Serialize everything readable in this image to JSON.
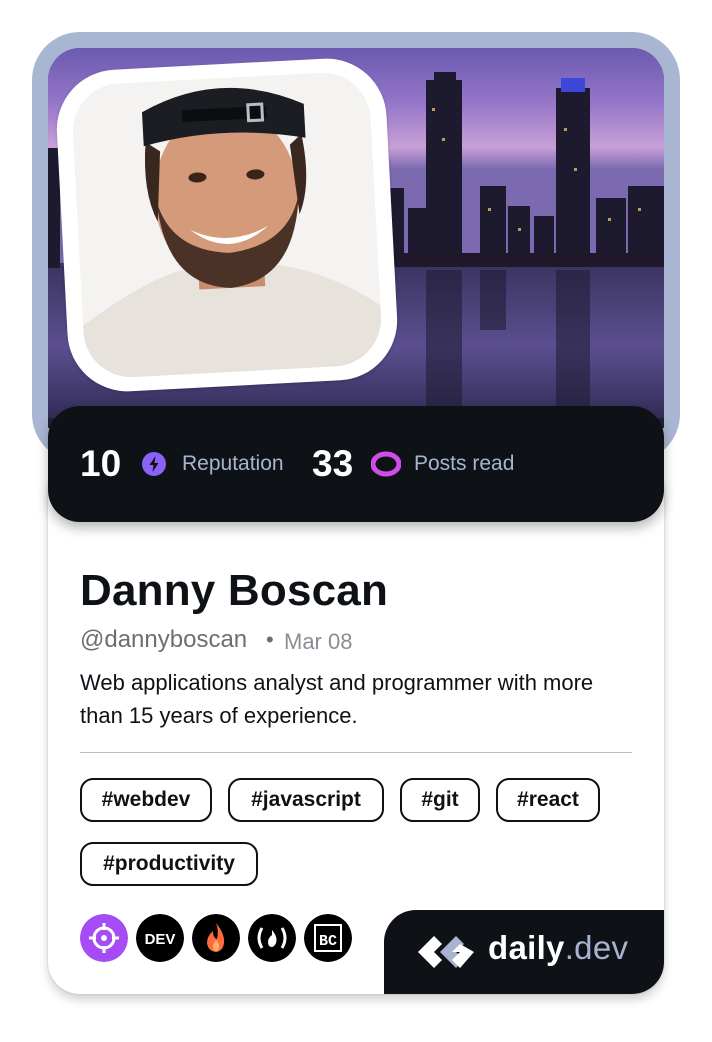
{
  "stats": {
    "reputation_value": "10",
    "reputation_label": "Reputation",
    "posts_value": "33",
    "posts_label": "Posts read"
  },
  "profile": {
    "name": "Danny Boscan",
    "handle": "@dannyboscan",
    "separator": "•",
    "date": "Mar 08",
    "bio": "Web applications analyst and programmer with more than 15 years of experience."
  },
  "tags": [
    "#webdev",
    "#javascript",
    "#git",
    "#react",
    "#productivity"
  ],
  "sources": [
    {
      "icon": "crosshair-icon",
      "color": "#a54cf5"
    },
    {
      "icon": "dev-icon",
      "color": "#000000"
    },
    {
      "icon": "flame-icon",
      "color": "#000000"
    },
    {
      "icon": "freecodecamp-icon",
      "color": "#000000"
    },
    {
      "icon": "bc-icon",
      "color": "#000000"
    }
  ],
  "brand": {
    "name_main": "daily",
    "name_suffix": ".dev"
  },
  "colors": {
    "frame": "#a9b6d1",
    "dark": "#0e1217",
    "reputation_icon": "#8c61f5",
    "posts_icon": "#d04dea",
    "muted": "#a8b3cf"
  }
}
